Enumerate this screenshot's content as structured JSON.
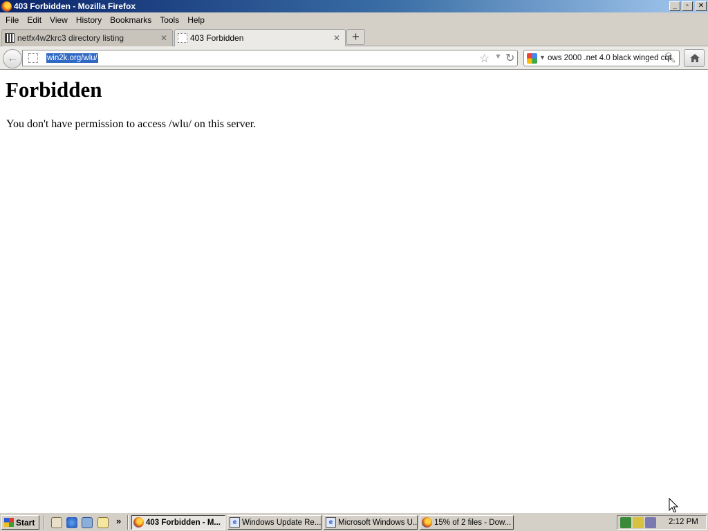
{
  "window": {
    "title": "403 Forbidden - Mozilla Firefox"
  },
  "menu": [
    "File",
    "Edit",
    "View",
    "History",
    "Bookmarks",
    "Tools",
    "Help"
  ],
  "tabs": [
    {
      "label": "netfx4w2krc3 directory listing",
      "active": false
    },
    {
      "label": "403 Forbidden",
      "active": true
    }
  ],
  "nav": {
    "url": "win2k.org/wlu/",
    "search_text": "ows 2000 .net 4.0 black winged cqt"
  },
  "page": {
    "heading": "Forbidden",
    "message": "You don't have permission to access /wlu/ on this server."
  },
  "taskbar": {
    "start_label": "Start",
    "tasks": [
      {
        "label": "403 Forbidden - M...",
        "icon": "firefox-icon",
        "active": true
      },
      {
        "label": "Windows Update Re...",
        "icon": "ie-icon",
        "active": false
      },
      {
        "label": "Microsoft Windows U...",
        "icon": "ie-icon",
        "active": false
      },
      {
        "label": "15% of 2 files - Dow...",
        "icon": "firefox-icon",
        "active": false
      }
    ],
    "clock": "2:12 PM"
  },
  "colors": {
    "titlebar_start": "#0a246a",
    "titlebar_end": "#a6caf0",
    "chrome": "#d4d0c8",
    "url_selection": "#316ac5"
  }
}
